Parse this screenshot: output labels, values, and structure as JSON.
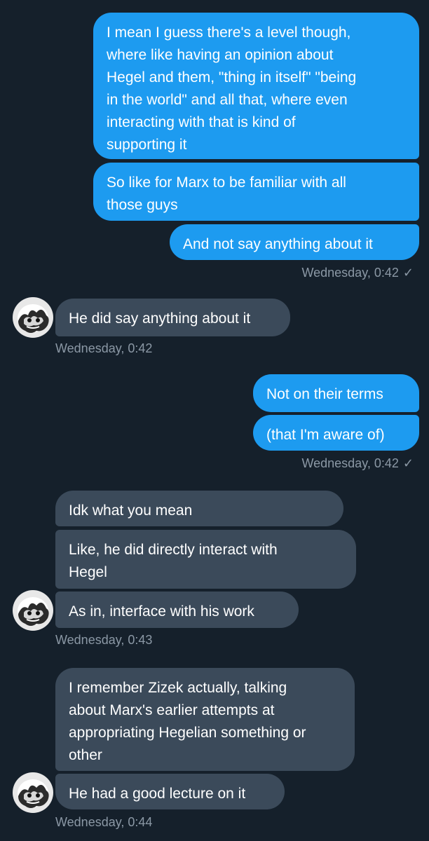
{
  "conversation": {
    "messages": [
      {
        "side": "sent",
        "text": "I mean I guess there's a level though,\nwhere like having an opinion about\nHegel and them, \"thing in itself\" \"being\nin the world\" and all that, where even\ninteracting with that is kind of\nsupporting it"
      },
      {
        "side": "sent",
        "text": "So like for Marx to be familiar with all\nthose guys"
      },
      {
        "side": "sent",
        "text": "And not say anything about it"
      },
      {
        "side": "recv",
        "text": "He did say anything about it"
      },
      {
        "side": "sent",
        "text": "Not on their terms"
      },
      {
        "side": "sent",
        "text": "(that I'm aware of)"
      },
      {
        "side": "recv",
        "text": "Idk what you mean"
      },
      {
        "side": "recv",
        "text": "Like, he did directly interact with\nHegel"
      },
      {
        "side": "recv",
        "text": "As in, interface with his work"
      },
      {
        "side": "recv",
        "text": "I remember Zizek actually, talking\nabout Marx's earlier attempts at\nappropriating Hegelian something or\nother"
      },
      {
        "side": "recv",
        "text": "He had a good lecture on it"
      }
    ],
    "timestamps": [
      {
        "text": "Wednesday, 0:42",
        "read_check": "✓"
      },
      {
        "text": "Wednesday, 0:42"
      },
      {
        "text": "Wednesday, 0:42",
        "read_check": "✓"
      },
      {
        "text": "Wednesday, 0:43"
      },
      {
        "text": "Wednesday, 0:44"
      }
    ],
    "avatar_icon": "avatar-icon"
  },
  "colors": {
    "background": "#15202b",
    "sent_bubble": "#1d9bf0",
    "received_bubble": "#3b4a5a",
    "timestamp": "#8b98a5",
    "text": "#ffffff"
  }
}
